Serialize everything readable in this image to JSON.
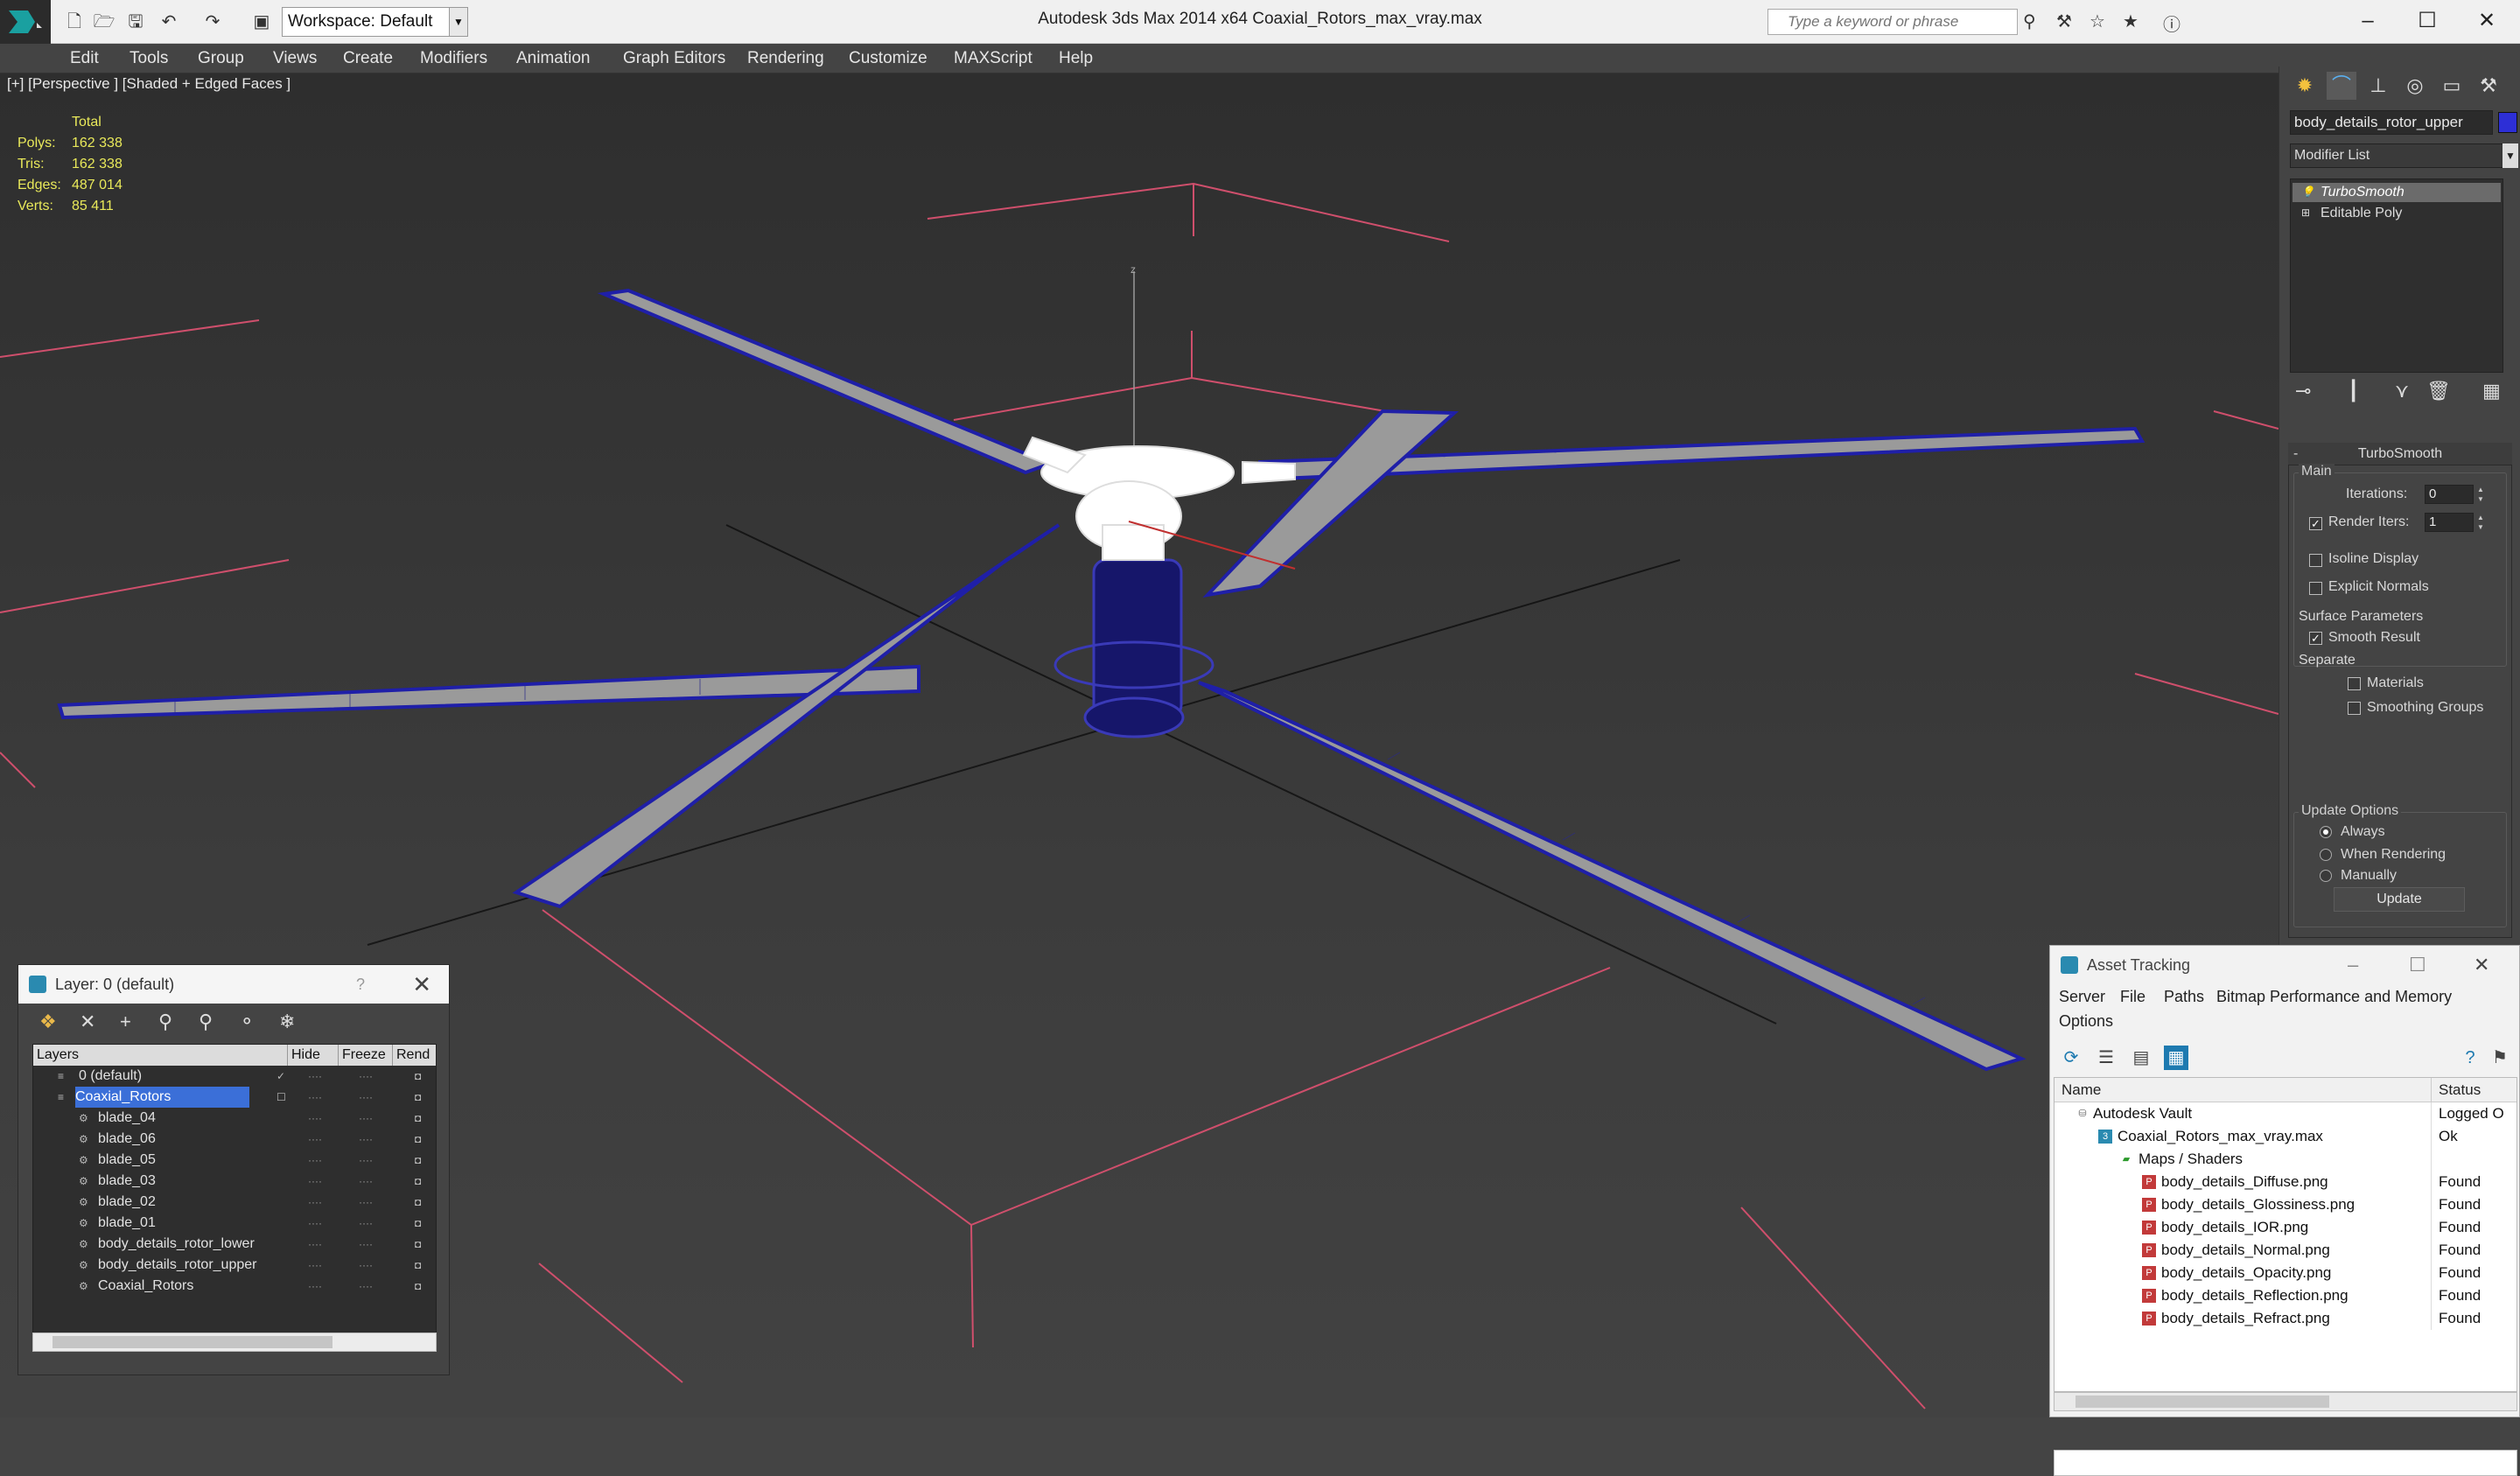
{
  "app": {
    "title": "Autodesk 3ds Max  2014 x64      Coaxial_Rotors_max_vray.max",
    "workspace": "Workspace: Default",
    "search_placeholder": "Type a keyword or phrase"
  },
  "menu": [
    "Edit",
    "Tools",
    "Group",
    "Views",
    "Create",
    "Modifiers",
    "Animation",
    "Graph Editors",
    "Rendering",
    "Customize",
    "MAXScript",
    "Help"
  ],
  "viewport": {
    "label": "[+] [Perspective ] [Shaded + Edged Faces ]",
    "stats_header": "Total",
    "stats": [
      {
        "label": "Polys:",
        "value": "162 338"
      },
      {
        "label": "Tris:",
        "value": "162 338"
      },
      {
        "label": "Edges:",
        "value": "487 014"
      },
      {
        "label": "Verts:",
        "value": "85 411"
      }
    ],
    "axis_label": "z",
    "colors": {
      "wire": "#1f1fa8",
      "blade": "#9a9a9a",
      "grid": "#cf4f6c",
      "hub": "#ffffff"
    }
  },
  "command_panel": {
    "object_name": "body_details_rotor_upper",
    "object_color": "#2d2fd6",
    "modifier_list": "Modifier List",
    "stack": [
      "TurboSmooth",
      "Editable Poly"
    ],
    "rollout_title": "TurboSmooth",
    "main_label": "Main",
    "iterations_label": "Iterations:",
    "iterations_value": "0",
    "render_iters_label": "Render Iters:",
    "render_iters_value": "1",
    "render_iters_checked": true,
    "isoline_label": "Isoline Display",
    "explicit_normals_label": "Explicit Normals",
    "surface_params_label": "Surface Parameters",
    "smooth_result_label": "Smooth Result",
    "smooth_result_checked": true,
    "separate_label": "Separate",
    "materials_label": "Materials",
    "smoothing_groups_label": "Smoothing Groups",
    "update_options_label": "Update Options",
    "update_always": "Always",
    "update_when_rendering": "When Rendering",
    "update_manually": "Manually",
    "update_button": "Update"
  },
  "layer_dialog": {
    "title": "Layer: 0 (default)",
    "help": "?",
    "columns": [
      "Layers",
      "Hide",
      "Freeze",
      "Rend"
    ],
    "rows": [
      {
        "name": "0 (default)"
      },
      {
        "name": "Coaxial_Rotors"
      },
      {
        "name": "blade_04"
      },
      {
        "name": "blade_06"
      },
      {
        "name": "blade_05"
      },
      {
        "name": "blade_03"
      },
      {
        "name": "blade_02"
      },
      {
        "name": "blade_01"
      },
      {
        "name": "body_details_rotor_lower"
      },
      {
        "name": "body_details_rotor_upper"
      },
      {
        "name": "Coaxial_Rotors"
      }
    ]
  },
  "asset_dialog": {
    "title": "Asset Tracking",
    "menu": [
      "Server",
      "File",
      "Paths",
      "Bitmap Performance and Memory",
      "Options"
    ],
    "columns": [
      "Name",
      "Status"
    ],
    "rows": [
      {
        "name": "Autodesk Vault",
        "status": "Logged O"
      },
      {
        "name": "Coaxial_Rotors_max_vray.max",
        "status": "Ok"
      },
      {
        "name": "Maps / Shaders",
        "status": ""
      },
      {
        "name": "body_details_Diffuse.png",
        "status": "Found"
      },
      {
        "name": "body_details_Glossiness.png",
        "status": "Found"
      },
      {
        "name": "body_details_IOR.png",
        "status": "Found"
      },
      {
        "name": "body_details_Normal.png",
        "status": "Found"
      },
      {
        "name": "body_details_Opacity.png",
        "status": "Found"
      },
      {
        "name": "body_details_Reflection.png",
        "status": "Found"
      },
      {
        "name": "body_details_Refract.png",
        "status": "Found"
      }
    ]
  }
}
